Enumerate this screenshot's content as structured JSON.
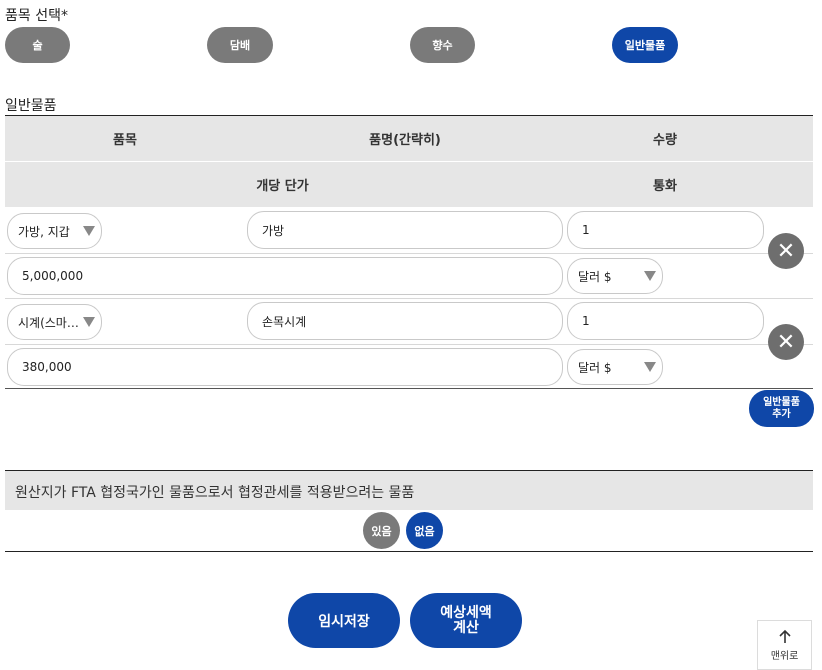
{
  "category": {
    "title": "품목 선택*",
    "buttons": [
      {
        "label": "술",
        "selected": false
      },
      {
        "label": "담배",
        "selected": false
      },
      {
        "label": "향수",
        "selected": false
      },
      {
        "label": "일반물품",
        "selected": true
      }
    ]
  },
  "general": {
    "section_title": "일반물품",
    "headers": {
      "item": "품목",
      "name": "품명(간략히)",
      "qty": "수량",
      "unit_price": "개당 단가",
      "currency": "통화"
    },
    "rows": [
      {
        "item": "가방, 지갑",
        "name": "가방",
        "qty": "1",
        "price": "5,000,000",
        "currency": "달러 $"
      },
      {
        "item": "시계(스마…",
        "name": "손목시계",
        "qty": "1",
        "price": "380,000",
        "currency": "달러 $"
      }
    ],
    "add_button": "일반물품 추가"
  },
  "fta": {
    "question": "원산지가 FTA 협정국가인 물품으로서 협정관세를 적용받으려는 물품",
    "yes": "있음",
    "no": "없음"
  },
  "actions": {
    "save": "임시저장",
    "calc": "예상세액 계산",
    "top": "맨위로"
  },
  "colors": {
    "accent": "#0f47a8",
    "gray": "#7a7a7a"
  }
}
